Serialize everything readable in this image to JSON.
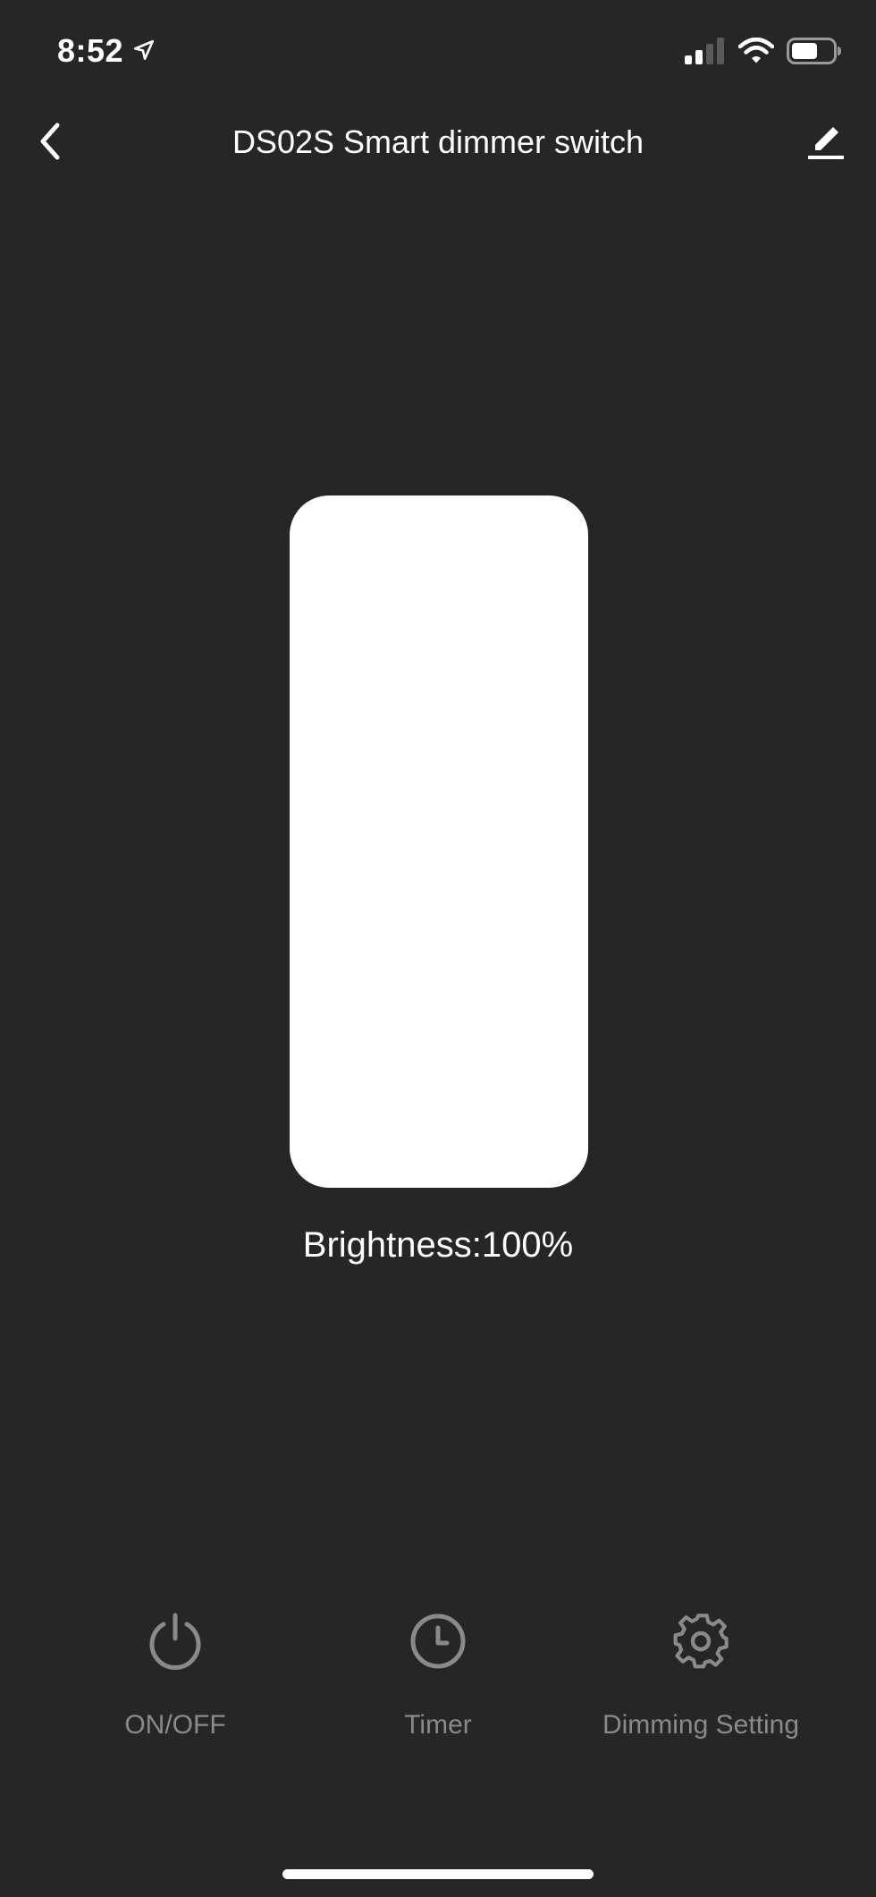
{
  "status_bar": {
    "time": "8:52",
    "location_icon": "location-arrow-icon",
    "signal_icon": "cellular-signal-icon",
    "wifi_icon": "wifi-icon",
    "battery_icon": "battery-icon"
  },
  "nav": {
    "title": "DS02S Smart dimmer switch",
    "back_icon": "chevron-left-icon",
    "edit_icon": "pencil-icon"
  },
  "brightness": {
    "label": "Brightness:100%",
    "level_percent": 100,
    "fill_color": "#ffffff"
  },
  "actions": [
    {
      "label": "ON/OFF",
      "icon": "power-icon"
    },
    {
      "label": "Timer",
      "icon": "clock-icon"
    },
    {
      "label": "Dimming Setting",
      "icon": "gear-icon"
    }
  ],
  "colors": {
    "background": "#262626",
    "text_primary": "#ffffff",
    "text_muted": "#8a8a8a"
  }
}
